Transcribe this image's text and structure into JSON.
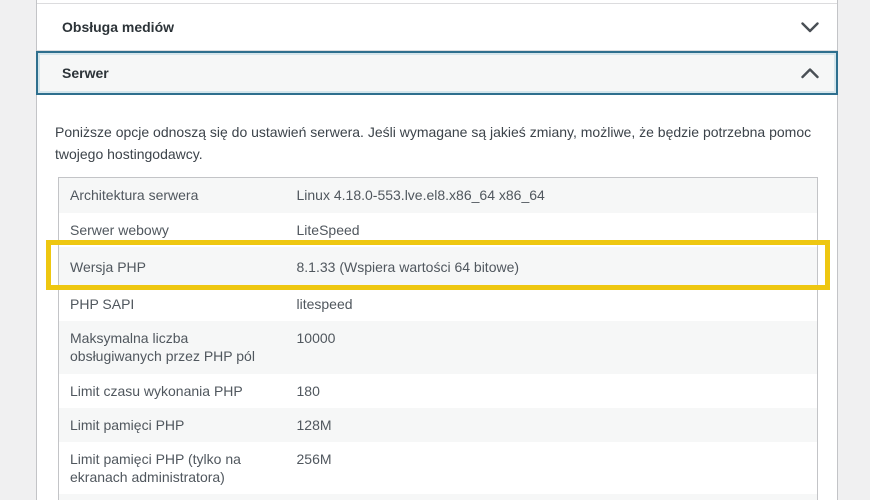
{
  "accordion": {
    "sections": [
      {
        "label": "Obsługa mediów",
        "state": "collapsed",
        "icon": "chevron-down"
      },
      {
        "label": "Serwer",
        "state": "expanded",
        "icon": "chevron-up"
      }
    ]
  },
  "server_section": {
    "description": "Poniższe opcje odnoszą się do ustawień serwera. Jeśli wymagane są jakieś zmiany, możliwe, że będzie potrzebna pomoc twojego hostingodawcy.",
    "table": {
      "rows": [
        {
          "label": "Architektura serwera",
          "value": "Linux 4.18.0-553.lve.el8.x86_64 x86_64"
        },
        {
          "label": "Serwer webowy",
          "value": "LiteSpeed"
        },
        {
          "label": "Wersja PHP",
          "value": "8.1.33 (Wspiera wartości 64 bitowe)",
          "highlighted": true
        },
        {
          "label": "PHP SAPI",
          "value": "litespeed"
        },
        {
          "label": "Maksymalna liczba obsługiwanych przez PHP pól",
          "value": "10000"
        },
        {
          "label": "Limit czasu wykonania PHP",
          "value": "180"
        },
        {
          "label": "Limit pamięci PHP",
          "value": "128M"
        },
        {
          "label": "Limit pamięci PHP (tylko na ekranach administratora)",
          "value": "256M"
        }
      ]
    }
  },
  "colors": {
    "page_background": "#f0f0f1",
    "panel_border": "#c3c4c7",
    "focus_border": "#2e6f8e",
    "row_stripe": "#f6f7f7",
    "highlight_annotation": "#eec711"
  }
}
